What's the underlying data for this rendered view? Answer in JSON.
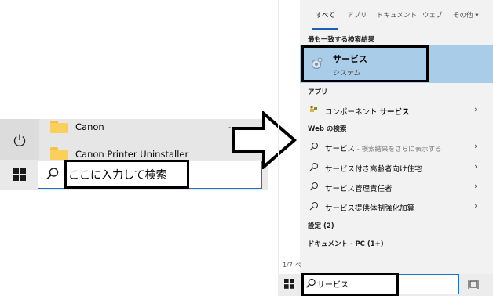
{
  "left_panel": {
    "apps": [
      {
        "label": "Canon",
        "icon": "folder-icon"
      },
      {
        "label": "Canon Printer Uninstaller",
        "icon": "folder-icon"
      }
    ],
    "power_icon": "power-icon",
    "search": {
      "text": "ここに入力して検索",
      "icon": "search-icon"
    }
  },
  "search_panel": {
    "tabs": [
      "すべて",
      "アプリ",
      "ドキュメント",
      "ウェブ",
      "その他 ▾"
    ],
    "best_match_header": "最も一致する検索結果",
    "best_match": {
      "title": "サービス",
      "subtitle": "システム",
      "icon": "gear-icon"
    },
    "apps_header": "アプリ",
    "apps": [
      {
        "label_prefix": "コンポーネント ",
        "label_bold": "サービス",
        "icon": "component-services-icon"
      }
    ],
    "web_header": "Web の検索",
    "web_results": [
      {
        "label": "サービス",
        "suffix": " - 検索結果をさらに表示する"
      },
      {
        "label": "サービス付き高齢者向け住宅",
        "suffix": ""
      },
      {
        "label": "サービス管理責任者",
        "suffix": ""
      },
      {
        "label": "サービス提供体制強化加算",
        "suffix": ""
      }
    ],
    "settings_label": "設定 (2)",
    "documents_label": "ドキュメント - PC (1+)",
    "page_indicator": "1/7 ペ",
    "search": {
      "text": "サービス",
      "icon": "search-icon"
    }
  },
  "colors": {
    "accent": "#1f72c6",
    "best_match_bg": "#a9cce8",
    "panel_bg": "#f2f2f2"
  }
}
